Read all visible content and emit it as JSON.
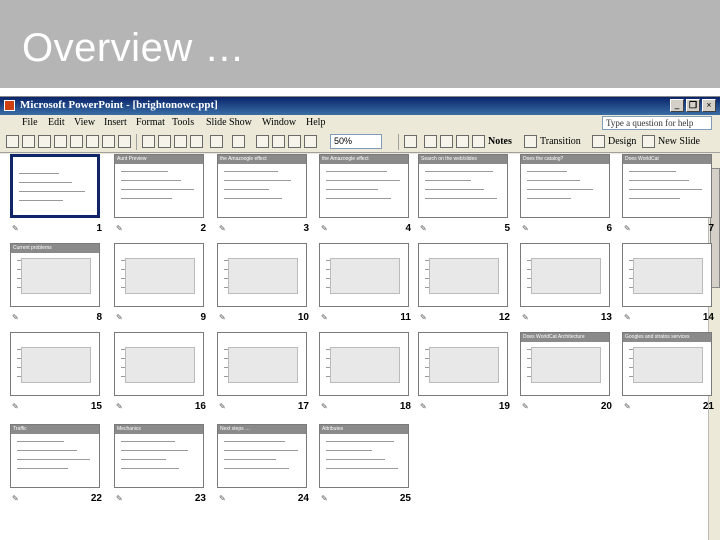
{
  "slide": {
    "title": "Overview …"
  },
  "window": {
    "title": "Microsoft PowerPoint - [brightonowc.ppt]",
    "controls": [
      "_",
      "❐",
      "×"
    ]
  },
  "menu": {
    "items": [
      "File",
      "Edit",
      "View",
      "Insert",
      "Format",
      "Tools",
      "Slide Show",
      "Window",
      "Help"
    ],
    "help_placeholder": "Type a question for help"
  },
  "toolbar": {
    "zoom": "50%",
    "notes": "Notes",
    "transition": "Transition",
    "design": "Design",
    "new_slide": "New Slide"
  },
  "thumbnails": [
    {
      "num": "1",
      "head": ""
    },
    {
      "num": "2",
      "head": "Aunt Preview"
    },
    {
      "num": "3",
      "head": "the Amazoogle effect"
    },
    {
      "num": "4",
      "head": "the Amazoogle effect"
    },
    {
      "num": "5",
      "head": "Search on the web/slides"
    },
    {
      "num": "6",
      "head": "Does the catalog?"
    },
    {
      "num": "7",
      "head": "Does WorldCat"
    },
    {
      "num": "8",
      "head": "Current problems"
    },
    {
      "num": "9",
      "head": ""
    },
    {
      "num": "10",
      "head": ""
    },
    {
      "num": "11",
      "head": ""
    },
    {
      "num": "12",
      "head": ""
    },
    {
      "num": "13",
      "head": ""
    },
    {
      "num": "14",
      "head": ""
    },
    {
      "num": "15",
      "head": ""
    },
    {
      "num": "16",
      "head": ""
    },
    {
      "num": "17",
      "head": ""
    },
    {
      "num": "18",
      "head": ""
    },
    {
      "num": "19",
      "head": ""
    },
    {
      "num": "20",
      "head": "Does WorldCat Architecture"
    },
    {
      "num": "21",
      "head": "Googles and stratos services"
    },
    {
      "num": "22",
      "head": "Traffic"
    },
    {
      "num": "23",
      "head": "Mechanics"
    },
    {
      "num": "24",
      "head": "Next steps …"
    },
    {
      "num": "25",
      "head": "Attributes"
    }
  ]
}
